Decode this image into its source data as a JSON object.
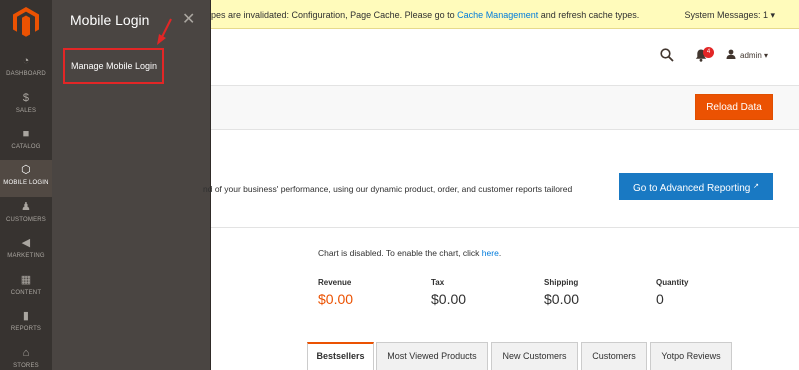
{
  "nav": {
    "logo_icon": "magento-logo-icon",
    "items": [
      {
        "label": "DASHBOARD",
        "icon": "speedometer-icon",
        "glyph": "◔"
      },
      {
        "label": "SALES",
        "icon": "dollar-icon",
        "glyph": "$"
      },
      {
        "label": "CATALOG",
        "icon": "box-icon",
        "glyph": "■"
      },
      {
        "label": "MOBILE LOGIN",
        "icon": "hexagon-icon",
        "glyph": "⬡"
      },
      {
        "label": "CUSTOMERS",
        "icon": "person-icon",
        "glyph": "♟"
      },
      {
        "label": "MARKETING",
        "icon": "megaphone-icon",
        "glyph": "◀"
      },
      {
        "label": "CONTENT",
        "icon": "layout-icon",
        "glyph": "▦"
      },
      {
        "label": "REPORTS",
        "icon": "bar-chart-icon",
        "glyph": "▮"
      },
      {
        "label": "STORES",
        "icon": "store-icon",
        "glyph": "⌂"
      }
    ]
  },
  "flyout": {
    "title": "Mobile Login",
    "close_glyph": "✕",
    "menu_item": "Manage Mobile Login"
  },
  "system_bar": {
    "message_prefix": "pes are invalidated: Configuration, Page Cache. Please go to ",
    "message_link": "Cache Management",
    "message_suffix": " and refresh cache types.",
    "system_messages": "System Messages: 1 ▾"
  },
  "header": {
    "notification_count": "4",
    "user_name": "admin ▾"
  },
  "actions": {
    "reload_label": "Reload Data"
  },
  "intro": {
    "text": "nd of your business' performance, using our dynamic product, order, and customer reports tailored",
    "advanced_button": "Go to Advanced Reporting",
    "external_glyph": "↗"
  },
  "chart_notice": {
    "text": "Chart is disabled. To enable the chart, click ",
    "link": "here",
    "suffix": "."
  },
  "stats": [
    {
      "label": "Revenue",
      "value": "$0.00"
    },
    {
      "label": "Tax",
      "value": "$0.00"
    },
    {
      "label": "Shipping",
      "value": "$0.00"
    },
    {
      "label": "Quantity",
      "value": "0"
    }
  ],
  "tabs": [
    "Bestsellers",
    "Most Viewed Products",
    "New Customers",
    "Customers",
    "Yotpo Reviews"
  ],
  "colors": {
    "accent": "#eb5202",
    "primary_button": "#1979c3",
    "nav_bg": "#373330",
    "flyout_bg": "#4a4542",
    "highlight_box": "#e22626"
  }
}
